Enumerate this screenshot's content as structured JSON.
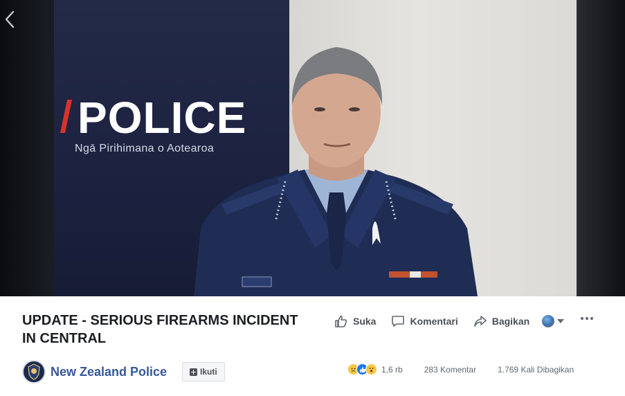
{
  "video": {
    "banner_word": "POLICE",
    "banner_subtitle": "Ngā Pirihimana o Aotearoa"
  },
  "post": {
    "title": "UPDATE - SERIOUS FIREARMS INCIDENT IN CENTRAL"
  },
  "actions": {
    "like_label": "Suka",
    "comment_label": "Komentari",
    "share_label": "Bagikan"
  },
  "page": {
    "name": "New Zealand Police",
    "follow_label": "Ikuti"
  },
  "stats": {
    "reaction_count": "1,6 rb",
    "comments": "283 Komentar",
    "shares": "1.769 Kali Dibagikan"
  },
  "icons": {
    "back": "chevron-left-icon",
    "like": "thumbs-up-icon",
    "comment": "speech-bubble-icon",
    "share": "share-arrow-icon",
    "audience": "globe-icon",
    "more": "more-dots-icon"
  },
  "colors": {
    "page_link": "#365899",
    "like_reaction": "#1877f2",
    "banner_navy": "#1c2240",
    "police_accent_red": "#d9322b"
  }
}
